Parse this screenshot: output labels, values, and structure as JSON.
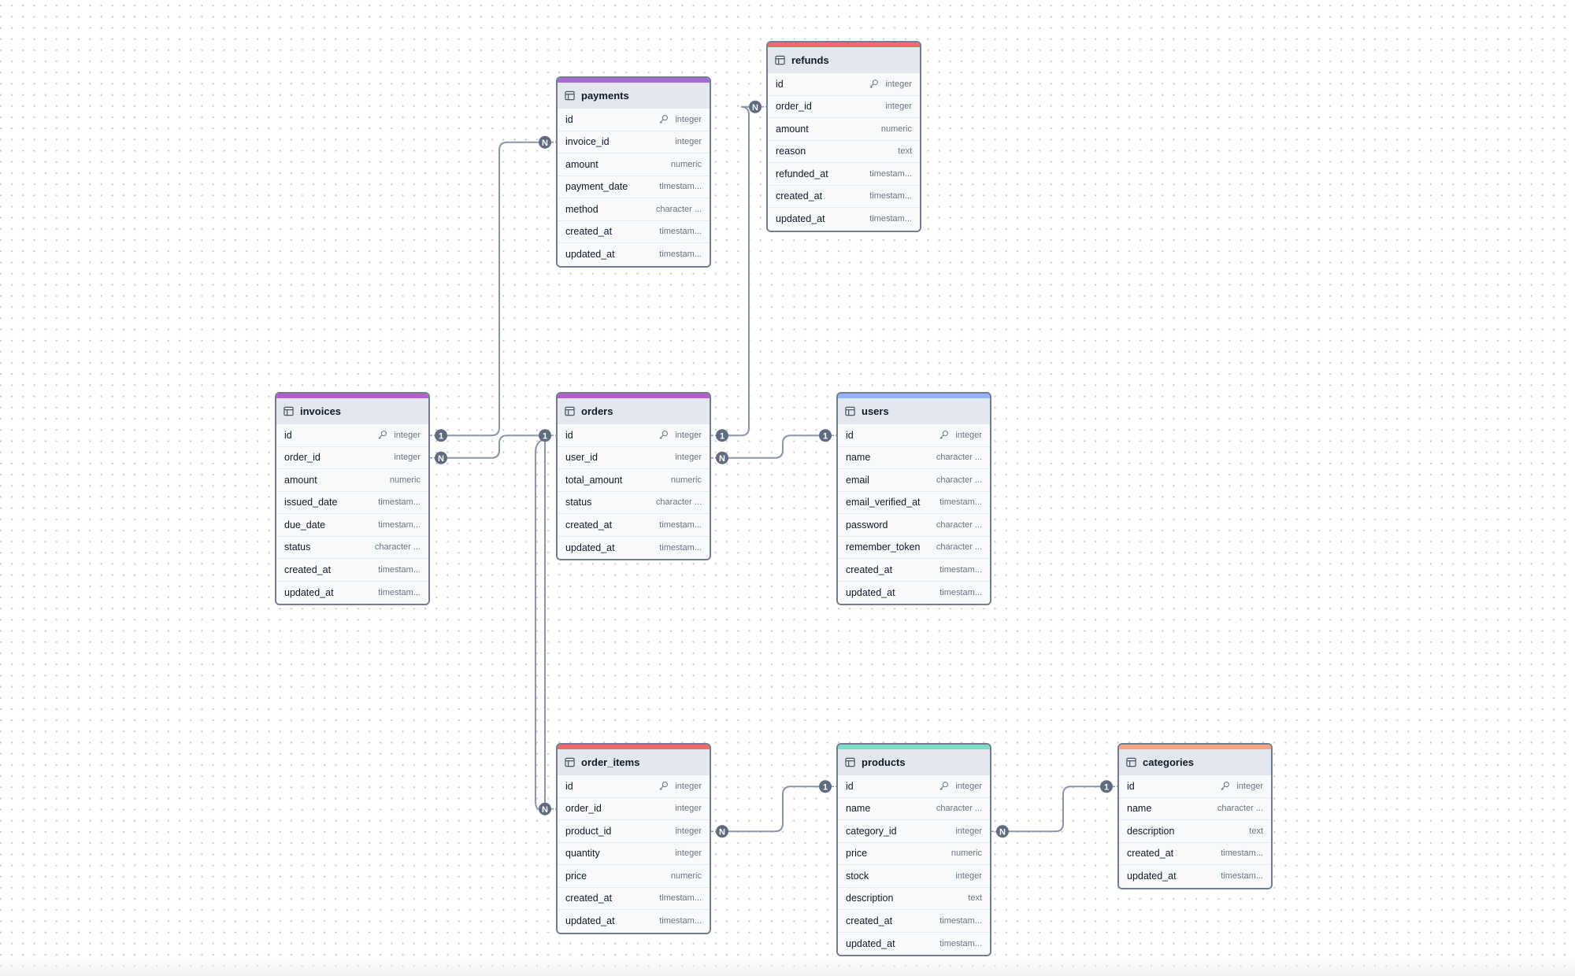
{
  "diagram": {
    "tables": [
      {
        "id": "payments",
        "name": "payments",
        "accent": "#a26ed6",
        "columns": [
          {
            "name": "id",
            "type": "integer",
            "pk": true
          },
          {
            "name": "invoice_id",
            "type": "integer"
          },
          {
            "name": "amount",
            "type": "numeric"
          },
          {
            "name": "payment_date",
            "type": "timestam..."
          },
          {
            "name": "method",
            "type": "character ..."
          },
          {
            "name": "created_at",
            "type": "timestam..."
          },
          {
            "name": "updated_at",
            "type": "timestam..."
          }
        ]
      },
      {
        "id": "refunds",
        "name": "refunds",
        "accent": "#ef6b6b",
        "columns": [
          {
            "name": "id",
            "type": "integer",
            "pk": true
          },
          {
            "name": "order_id",
            "type": "integer"
          },
          {
            "name": "amount",
            "type": "numeric"
          },
          {
            "name": "reason",
            "type": "text"
          },
          {
            "name": "refunded_at",
            "type": "timestam..."
          },
          {
            "name": "created_at",
            "type": "timestam..."
          },
          {
            "name": "updated_at",
            "type": "timestam..."
          }
        ]
      },
      {
        "id": "invoices",
        "name": "invoices",
        "accent": "#b160c9",
        "columns": [
          {
            "name": "id",
            "type": "integer",
            "pk": true
          },
          {
            "name": "order_id",
            "type": "integer"
          },
          {
            "name": "amount",
            "type": "numeric"
          },
          {
            "name": "issued_date",
            "type": "timestam..."
          },
          {
            "name": "due_date",
            "type": "timestam..."
          },
          {
            "name": "status",
            "type": "character ..."
          },
          {
            "name": "created_at",
            "type": "timestam..."
          },
          {
            "name": "updated_at",
            "type": "timestam..."
          }
        ]
      },
      {
        "id": "orders",
        "name": "orders",
        "accent": "#b160c9",
        "columns": [
          {
            "name": "id",
            "type": "integer",
            "pk": true
          },
          {
            "name": "user_id",
            "type": "integer"
          },
          {
            "name": "total_amount",
            "type": "numeric"
          },
          {
            "name": "status",
            "type": "character ..."
          },
          {
            "name": "created_at",
            "type": "timestam..."
          },
          {
            "name": "updated_at",
            "type": "timestam..."
          }
        ]
      },
      {
        "id": "users",
        "name": "users",
        "accent": "#93b4f2",
        "columns": [
          {
            "name": "id",
            "type": "integer",
            "pk": true
          },
          {
            "name": "name",
            "type": "character ..."
          },
          {
            "name": "email",
            "type": "character ..."
          },
          {
            "name": "email_verified_at",
            "type": "timestam..."
          },
          {
            "name": "password",
            "type": "character ..."
          },
          {
            "name": "remember_token",
            "type": "character ..."
          },
          {
            "name": "created_at",
            "type": "timestam..."
          },
          {
            "name": "updated_at",
            "type": "timestam..."
          }
        ]
      },
      {
        "id": "order_items",
        "name": "order_items",
        "accent": "#ef6b6b",
        "columns": [
          {
            "name": "id",
            "type": "integer",
            "pk": true
          },
          {
            "name": "order_id",
            "type": "integer"
          },
          {
            "name": "product_id",
            "type": "integer"
          },
          {
            "name": "quantity",
            "type": "integer"
          },
          {
            "name": "price",
            "type": "numeric"
          },
          {
            "name": "created_at",
            "type": "timestam..."
          },
          {
            "name": "updated_at",
            "type": "timestam..."
          }
        ]
      },
      {
        "id": "products",
        "name": "products",
        "accent": "#7fdcc4",
        "columns": [
          {
            "name": "id",
            "type": "integer",
            "pk": true
          },
          {
            "name": "name",
            "type": "character ..."
          },
          {
            "name": "category_id",
            "type": "integer"
          },
          {
            "name": "price",
            "type": "numeric"
          },
          {
            "name": "stock",
            "type": "integer"
          },
          {
            "name": "description",
            "type": "text"
          },
          {
            "name": "created_at",
            "type": "timestam..."
          },
          {
            "name": "updated_at",
            "type": "timestam..."
          }
        ]
      },
      {
        "id": "categories",
        "name": "categories",
        "accent": "#f4a47e",
        "columns": [
          {
            "name": "id",
            "type": "integer",
            "pk": true
          },
          {
            "name": "name",
            "type": "character ..."
          },
          {
            "name": "description",
            "type": "text"
          },
          {
            "name": "created_at",
            "type": "timestam..."
          },
          {
            "name": "updated_at",
            "type": "timestam..."
          }
        ]
      }
    ],
    "relationships": [
      {
        "from_table": "payments",
        "from_column": "invoice_id",
        "from_card": "N",
        "to_table": "invoices",
        "to_column": "id",
        "to_card": "1"
      },
      {
        "from_table": "refunds",
        "from_column": "order_id",
        "from_card": "N",
        "to_table": "orders",
        "to_column": "id",
        "to_card": "1"
      },
      {
        "from_table": "invoices",
        "from_column": "order_id",
        "from_card": "N",
        "to_table": "orders",
        "to_column": "id",
        "to_card": "1"
      },
      {
        "from_table": "orders",
        "from_column": "user_id",
        "from_card": "N",
        "to_table": "users",
        "to_column": "id",
        "to_card": "1"
      },
      {
        "from_table": "order_items",
        "from_column": "order_id",
        "from_card": "N",
        "to_table": "orders",
        "to_column": "id",
        "to_card": "1"
      },
      {
        "from_table": "order_items",
        "from_column": "product_id",
        "from_card": "N",
        "to_table": "products",
        "to_column": "id",
        "to_card": "1"
      },
      {
        "from_table": "products",
        "from_column": "category_id",
        "from_card": "N",
        "to_table": "categories",
        "to_column": "id",
        "to_card": "1"
      }
    ],
    "colors": {
      "edge": "#8b95a7",
      "badge": "#5f6b80",
      "table_border": "#737d8f",
      "header_bg": "#e3e7ee"
    }
  }
}
